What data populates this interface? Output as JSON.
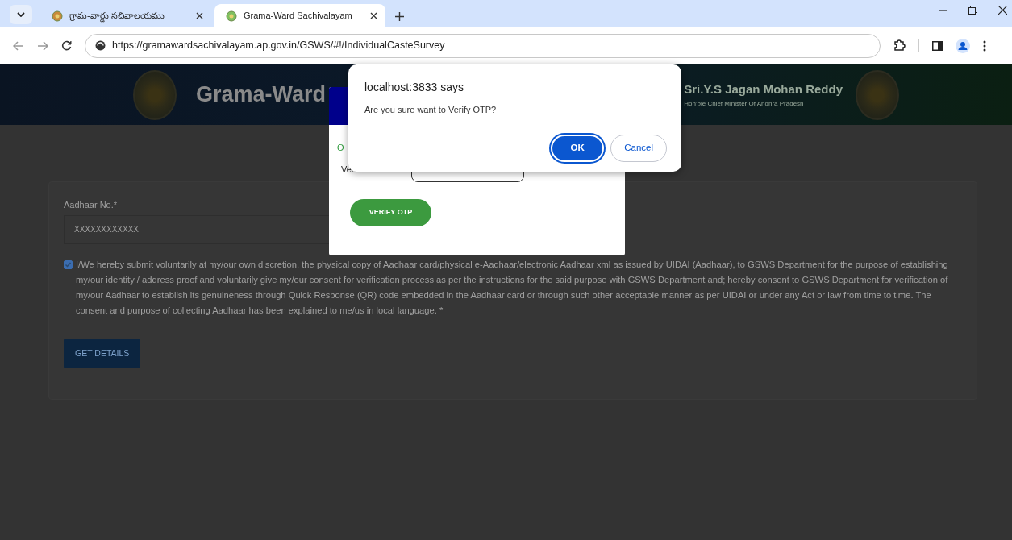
{
  "browser": {
    "tabs": [
      {
        "title": "గ్రామ-వార్డు సచివాలయము",
        "selected": false
      },
      {
        "title": "Grama-Ward Sachivalayam",
        "selected": true
      }
    ],
    "url": "https://gramawardsachivalayam.ap.gov.in/GSWS/#!/IndividualCasteSurvey"
  },
  "header": {
    "title": "Grama-Ward",
    "leader_name": "Sri.Y.S Jagan Mohan Reddy",
    "leader_title": "Hon'ble Chief Minister Of Andhra Pradesh"
  },
  "form": {
    "aadhaar_label": "Aadhaar No.*",
    "aadhaar_value": "XXXXXXXXXXXX",
    "consent_checked": true,
    "consent_text": "I/We hereby submit voluntarily at my/our own discretion, the physical copy of Aadhaar card/physical e-Aadhaar/electronic Aadhaar xml as issued by UIDAI (Aadhaar), to GSWS Department for the purpose of establishing my/our identity / address proof and voluntarily give my/our consent for verification process as per the instructions for the said purpose with GSWS Department and; hereby consent to GSWS Department for verification of my/our Aadhaar to establish its genuineness through Quick Response (QR) code embedded in the Aadhaar card or through such other acceptable manner as per UIDAI or under any Act or law from time to time. The consent and purpose of collecting Aadhaar has been explained to me/us in local language. *",
    "button": "GET DETAILS"
  },
  "otp_modal": {
    "status_text": "O",
    "otp_label": "Ver",
    "button": "VERIFY OTP"
  },
  "alert": {
    "title": "localhost:3833 says",
    "message": "Are you sure want to Verify OTP?",
    "buttons": [
      {
        "label": "OK",
        "focused": true
      },
      {
        "label": "Cancel",
        "focused": false
      }
    ]
  }
}
